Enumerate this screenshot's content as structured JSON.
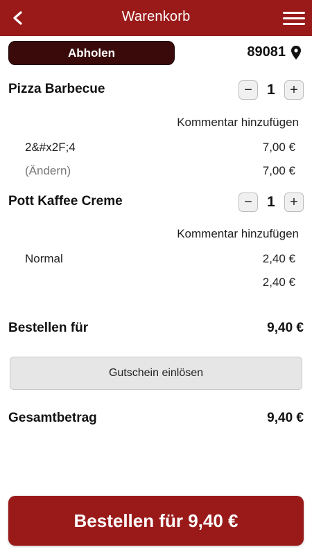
{
  "header": {
    "title": "Warenkorb",
    "back_icon": "chevron-left-icon",
    "menu_icon": "hamburger-menu-icon",
    "background_color": "#9a1a1a"
  },
  "delivery": {
    "pickup_label": "Abholen",
    "zip": "89081",
    "location_icon": "map-pin-icon"
  },
  "items": [
    {
      "name": "Pizza Barbecue",
      "quantity": "1",
      "comment_label": "Kommentar hinzufügen",
      "option_label": "2&#x2F;4",
      "option_price": "7,00 €",
      "change_label": "(Ändern)",
      "item_total": "7,00 €"
    },
    {
      "name": "Pott Kaffee Creme",
      "quantity": "1",
      "comment_label": "Kommentar hinzufügen",
      "option_label": "Normal",
      "option_price": "2,40 €",
      "item_total": "2,40 €"
    }
  ],
  "stepper": {
    "minus": "−",
    "plus": "+"
  },
  "summary": {
    "order_label": "Bestellen für",
    "order_value": "9,40 €",
    "voucher_label": "Gutschein einlösen",
    "total_label": "Gesamtbetrag",
    "total_value": "9,40 €"
  },
  "cta": {
    "label": "Bestellen für 9,40 €",
    "color": "#9a1a1a"
  }
}
